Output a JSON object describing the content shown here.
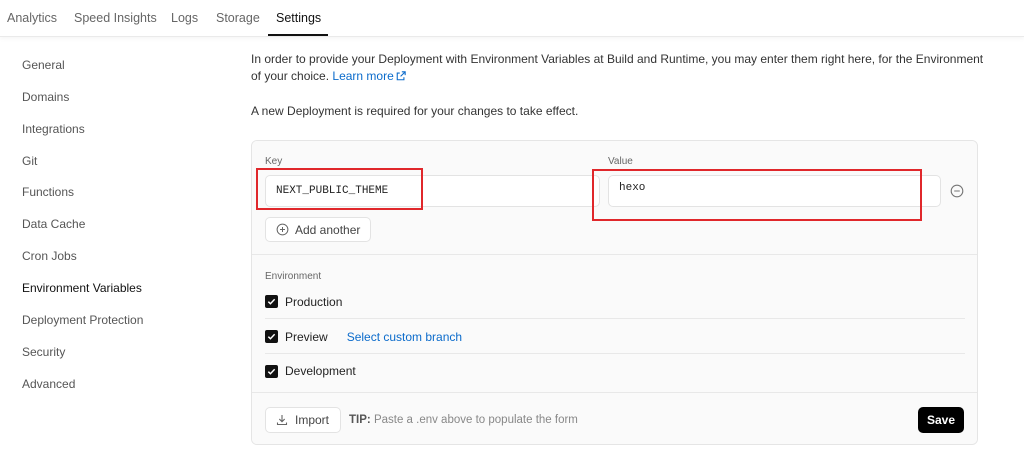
{
  "tabs": [
    {
      "label": "Analytics"
    },
    {
      "label": "Speed Insights"
    },
    {
      "label": "Logs"
    },
    {
      "label": "Storage"
    },
    {
      "label": "Settings",
      "active": true
    }
  ],
  "sidebar": {
    "items": [
      {
        "label": "General"
      },
      {
        "label": "Domains"
      },
      {
        "label": "Integrations"
      },
      {
        "label": "Git"
      },
      {
        "label": "Functions"
      },
      {
        "label": "Data Cache"
      },
      {
        "label": "Cron Jobs"
      },
      {
        "label": "Environment Variables",
        "active": true
      },
      {
        "label": "Deployment Protection"
      },
      {
        "label": "Security"
      },
      {
        "label": "Advanced"
      }
    ]
  },
  "main": {
    "intro_text": "In order to provide your Deployment with Environment Variables at Build and Runtime, you may enter them right here, for the Environment of your choice.",
    "learn_more": "Learn more",
    "notice": "A new Deployment is required for your changes to take effect.",
    "form": {
      "key_label": "Key",
      "value_label": "Value",
      "key_value": "NEXT_PUBLIC_THEME",
      "value_value": "hexo",
      "add_another": "Add another",
      "environment_label": "Environment",
      "environments": [
        {
          "label": "Production",
          "checked": true
        },
        {
          "label": "Preview",
          "checked": true,
          "link": "Select custom branch"
        },
        {
          "label": "Development",
          "checked": true
        }
      ],
      "import_label": "Import",
      "tip_label": "TIP:",
      "tip_text": "Paste a .env above to populate the form",
      "save_label": "Save"
    }
  },
  "colors": {
    "accent_link": "#0b6bcb",
    "highlight_box": "#e0272b",
    "primary_button": "#000000"
  }
}
